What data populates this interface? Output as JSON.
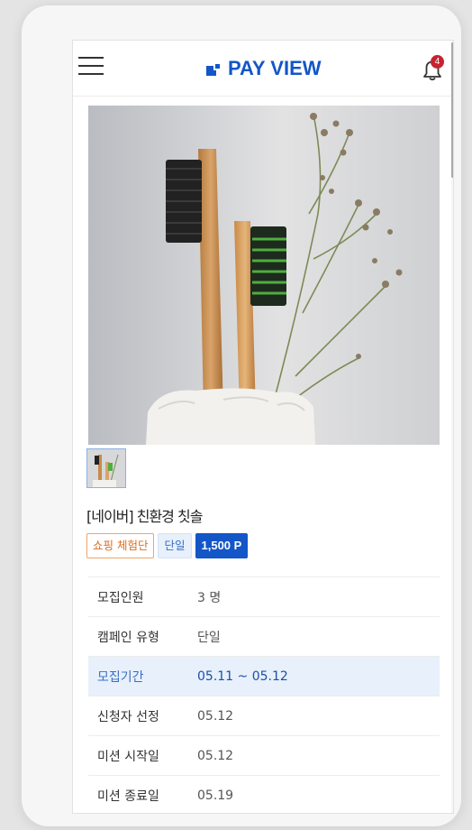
{
  "header": {
    "logo_text": "PAY VIEW",
    "notification_count": "4"
  },
  "product": {
    "image_alt": "Bamboo toothbrushes",
    "title": "[네이버] 친환경 칫솔",
    "tags": {
      "type": "쇼핑 체험단",
      "mode": "단일",
      "points": "1,500 P"
    }
  },
  "details": [
    {
      "label": "모집인원",
      "value": "3 명"
    },
    {
      "label": "캠페인 유형",
      "value": "단일"
    },
    {
      "label": "모집기간",
      "value": "05.11 ~ 05.12"
    },
    {
      "label": "신청자 선정",
      "value": "05.12"
    },
    {
      "label": "미션 시작일",
      "value": "05.12"
    },
    {
      "label": "미션 종료일",
      "value": "05.19"
    }
  ],
  "colors": {
    "brand": "#1356c8",
    "badge": "#c62230",
    "tag_orange": "#e06c1c",
    "highlight_bg": "#e7f0fb"
  }
}
